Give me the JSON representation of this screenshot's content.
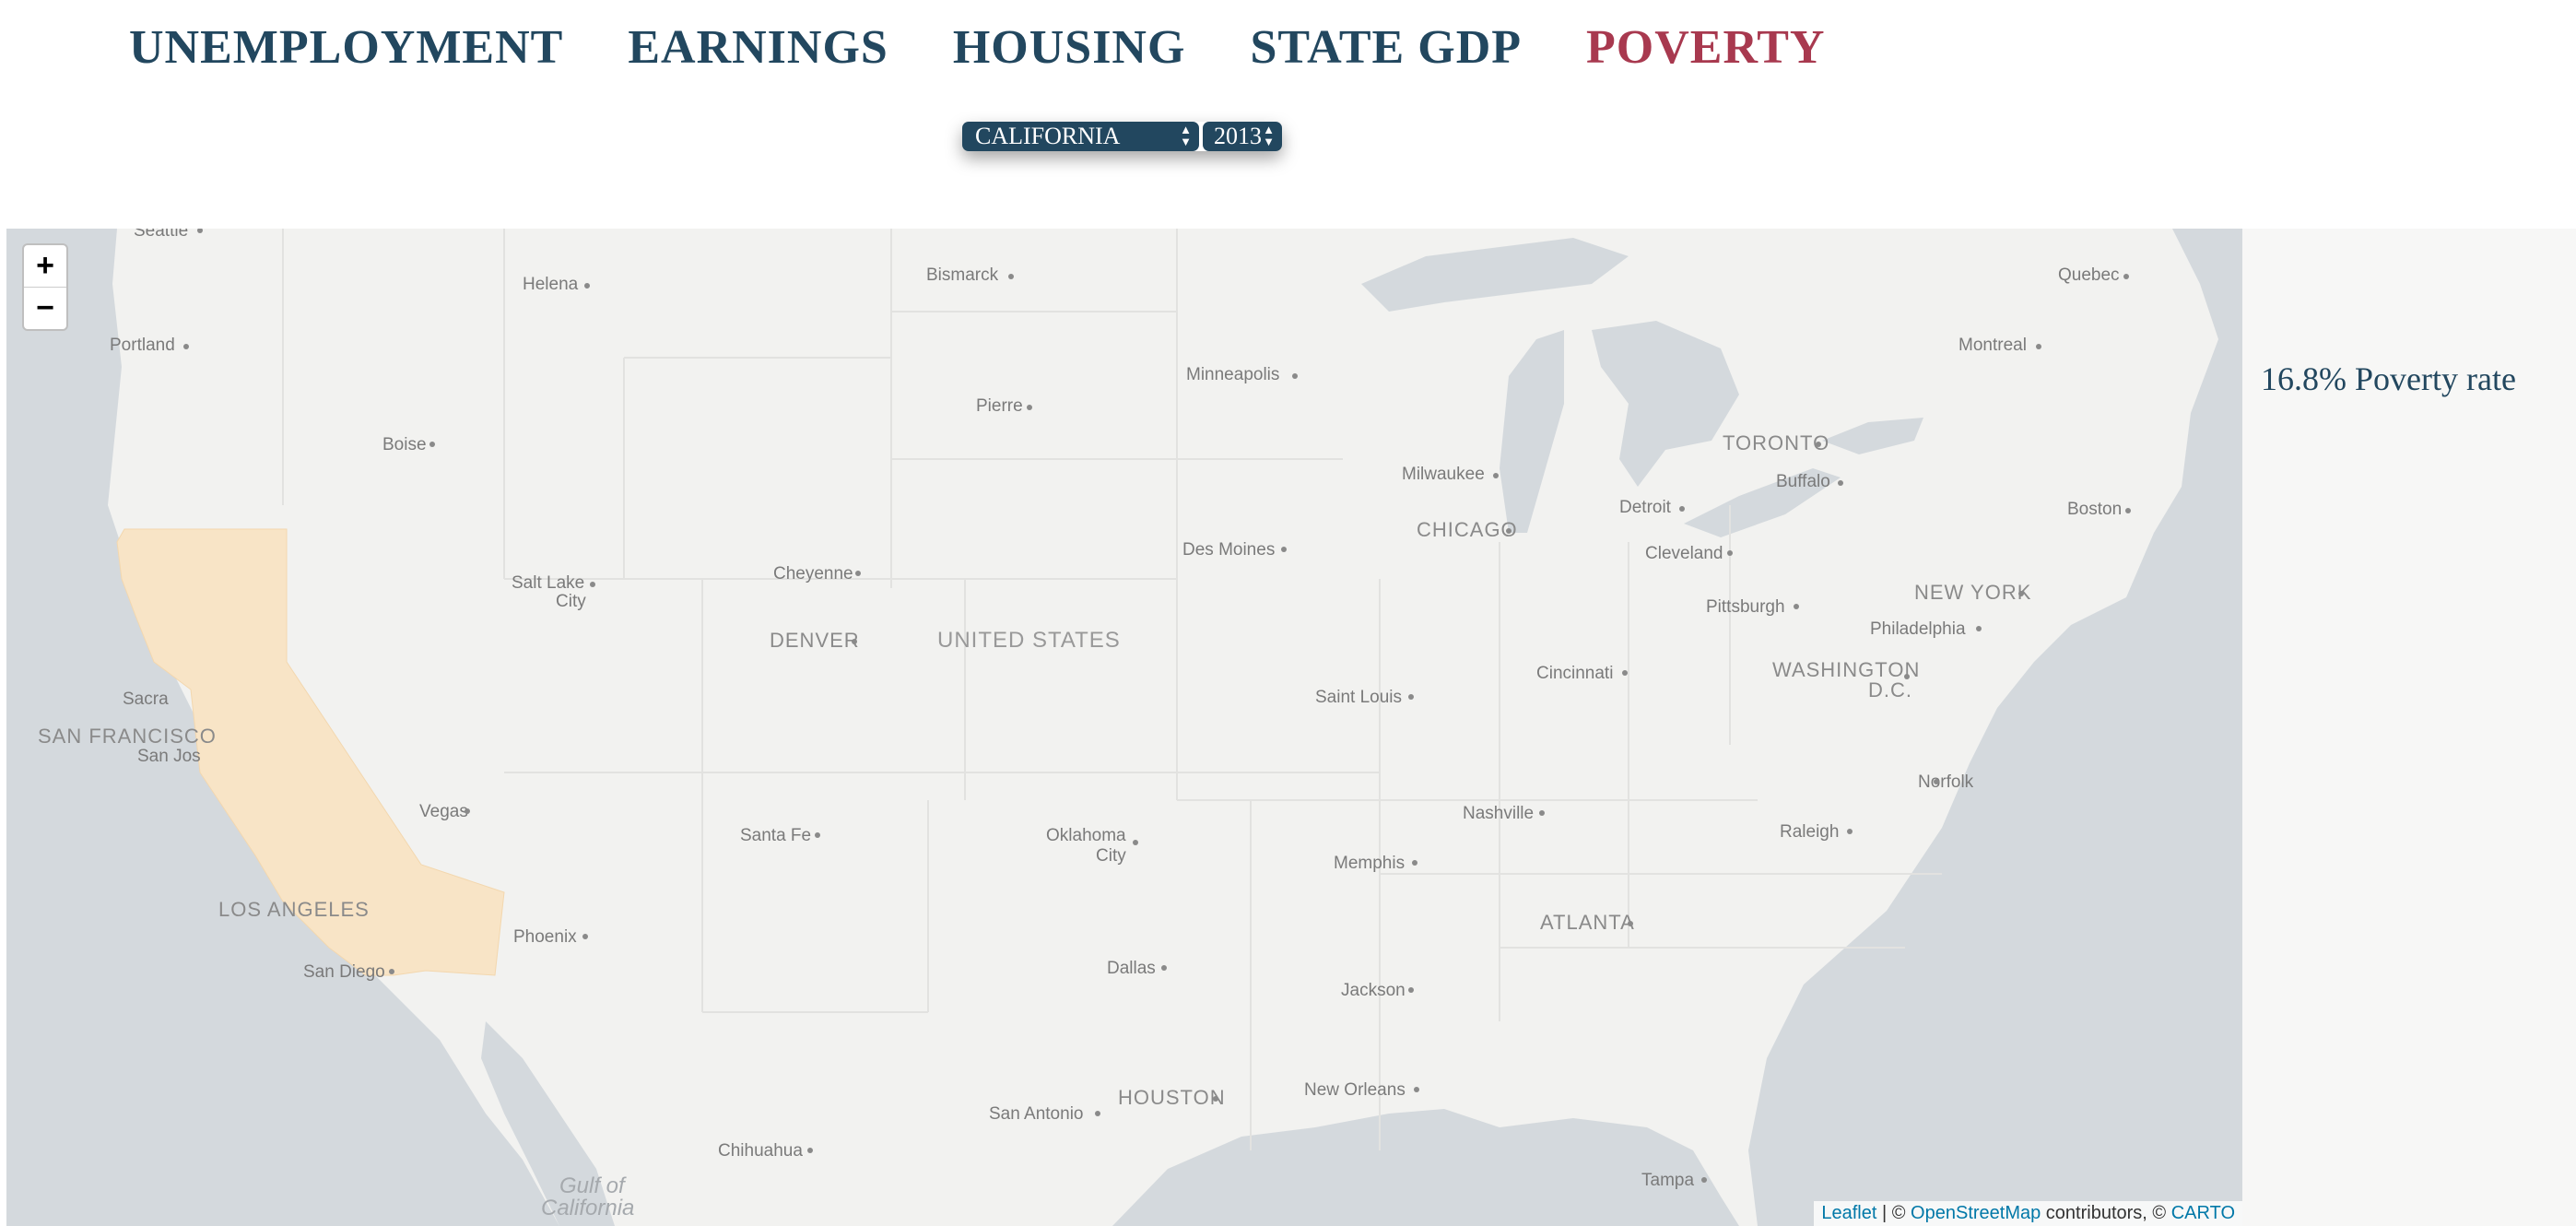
{
  "nav": {
    "items": [
      {
        "label": "UNEMPLOYMENT",
        "active": false
      },
      {
        "label": "EARNINGS",
        "active": false
      },
      {
        "label": "HOUSING",
        "active": false
      },
      {
        "label": "STATE GDP",
        "active": false
      },
      {
        "label": "POVERTY",
        "active": true
      }
    ]
  },
  "controls": {
    "state": "CALIFORNIA",
    "year": "2013"
  },
  "map": {
    "zoom_in": "+",
    "zoom_out": "−",
    "highlight_state": "California",
    "highlight_color": "#f8e4c6",
    "cities": [
      "Seattle",
      "Helena",
      "Bismarck",
      "Quebec",
      "Portland",
      "Montreal",
      "Minneapolis",
      "Pierre",
      "Boise",
      "TORONTO",
      "Milwaukee",
      "Buffalo",
      "Detroit",
      "CHICAGO",
      "Boston",
      "Des Moines",
      "Cleveland",
      "Salt Lake City",
      "Cheyenne",
      "Pittsburgh",
      "NEW YORK",
      "Philadelphia",
      "DENVER",
      "UNITED STATES",
      "WASHINGTON D.C.",
      "Cincinnati",
      "Sacramento",
      "SAN FRANCISCO",
      "San Jose",
      "Saint Louis",
      "Norfolk",
      "Las Vegas",
      "Nashville",
      "Santa Fe",
      "Oklahoma City",
      "Raleigh",
      "Memphis",
      "LOS ANGELES",
      "ATLANTA",
      "Phoenix",
      "San Diego",
      "Dallas",
      "Jackson",
      "HOUSTON",
      "New Orleans",
      "San Antonio",
      "Chihuahua",
      "Tampa",
      "Gulf of California"
    ],
    "attribution": {
      "leaflet": "Leaflet",
      "sep": " | © ",
      "osm": "OpenStreetMap",
      "mid": " contributors, © ",
      "carto": "CARTO"
    }
  },
  "sidebar": {
    "rate_text": "16.8% Poverty rate"
  }
}
